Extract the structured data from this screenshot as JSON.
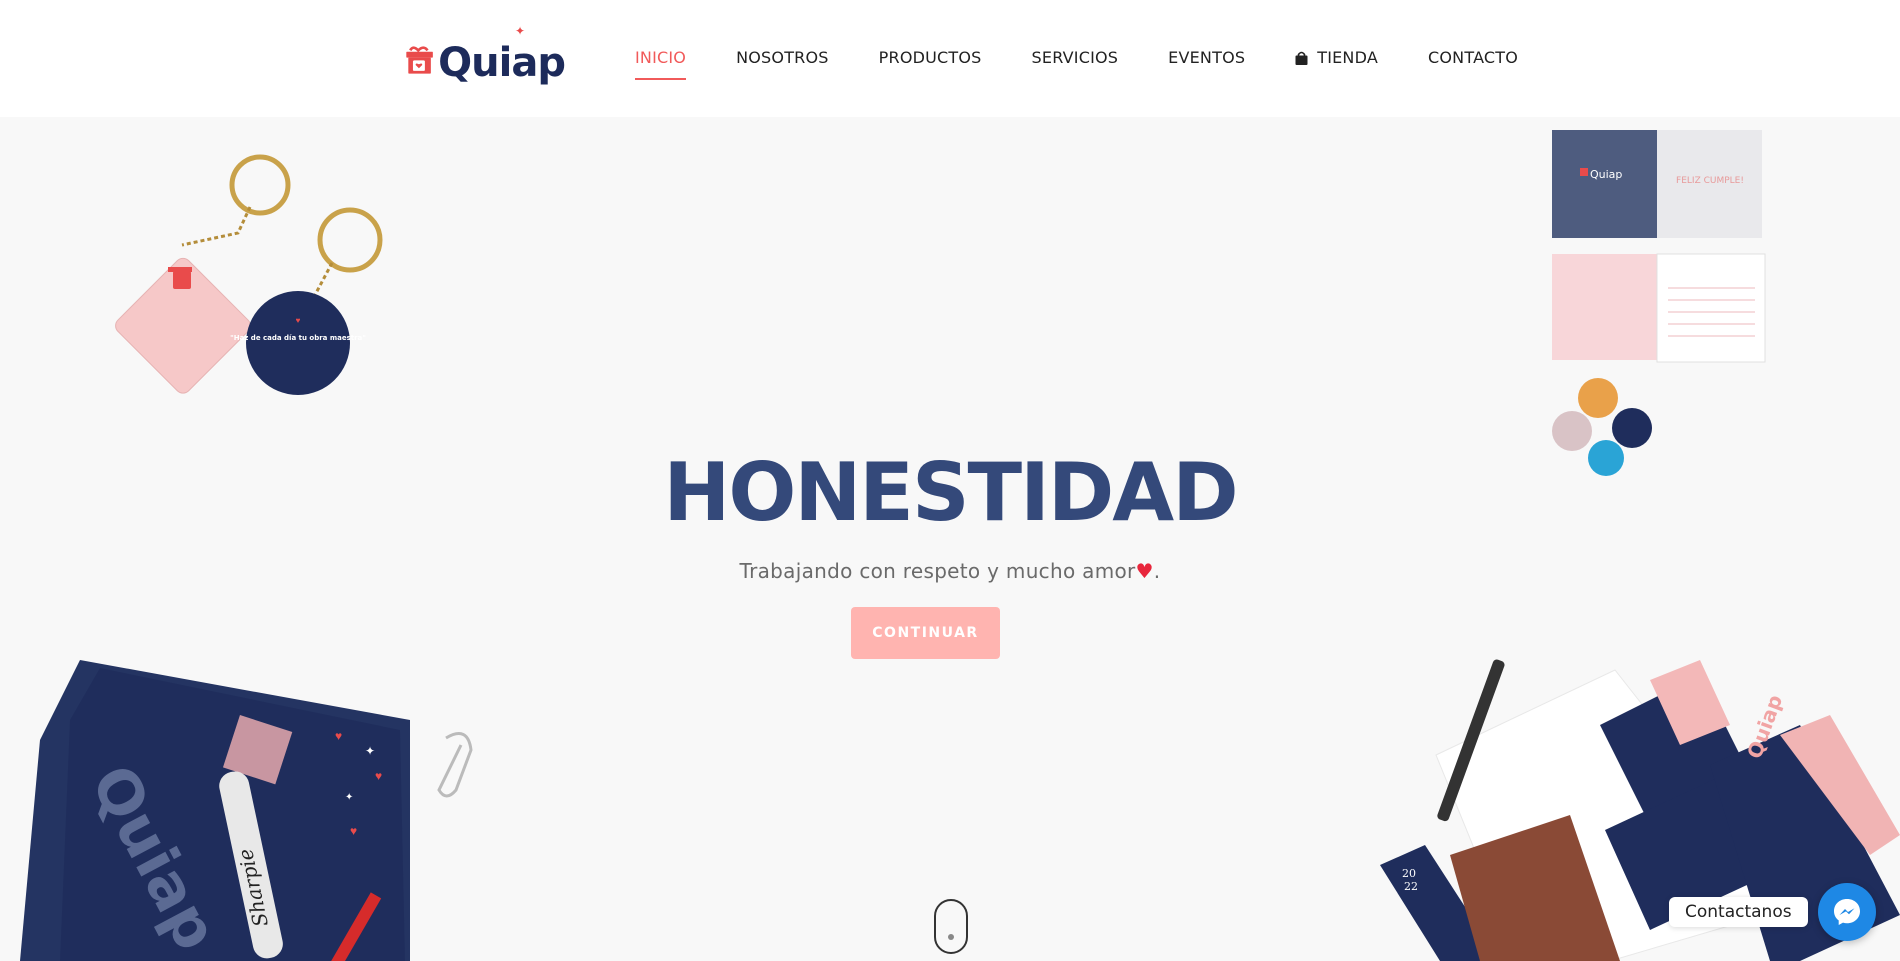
{
  "brand": {
    "name": "Quiap"
  },
  "nav": {
    "items": [
      {
        "label": "INICIO",
        "active": true
      },
      {
        "label": "NOSOTROS"
      },
      {
        "label": "PRODUCTOS"
      },
      {
        "label": "SERVICIOS"
      },
      {
        "label": "EVENTOS"
      },
      {
        "label": "TIENDA",
        "icon": "shopping-bag-icon"
      },
      {
        "label": "CONTACTO"
      }
    ]
  },
  "hero": {
    "title": "HONESTIDAD",
    "subtitle": "Trabajando con respeto y mucho amor",
    "subtitle_heart": "♥",
    "subtitle_end": ".",
    "cta_label": "CONTINUAR"
  },
  "keychain": {
    "quote": "\"Haz de cada día tu obra maestra\""
  },
  "card": {
    "greeting": "FELIZ CUMPLE!"
  },
  "box": {
    "brand": "Quiap",
    "marker": "Sharpie"
  },
  "stationery": {
    "year_top": "20",
    "year_bottom": "22",
    "brand": "Quiap"
  },
  "contact_widget": {
    "label": "Contactanos",
    "icon": "messenger-icon"
  },
  "colors": {
    "accent": "#f15a5a",
    "navy": "#1d2b5b",
    "title": "#34497a",
    "cta": "#ffb4b0",
    "messenger": "#1e88e5"
  }
}
